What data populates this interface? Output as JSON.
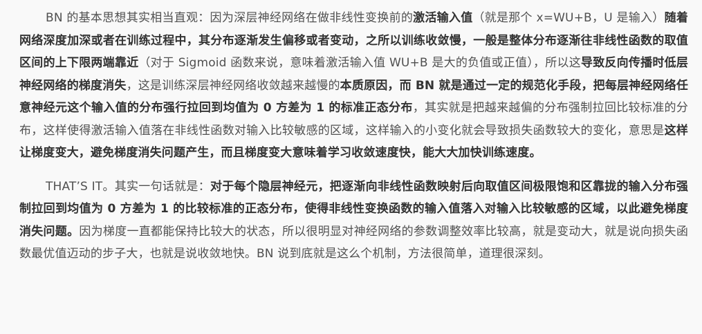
{
  "paragraph_1": [
    {
      "text": "BN 的基本思想其实相当直观：因为深层神经网络在做非线性变换前的",
      "bold": false
    },
    {
      "text": "激活输入值",
      "bold": true
    },
    {
      "text": "（就是那个 x=WU+B，U 是输入）",
      "bold": false
    },
    {
      "text": "随着网络深度加深或者在训练过程中，其分布逐渐发生偏移或者变动，之所以训练收敛慢，一般是整体分布逐渐往非线性函数的取值区间的上下限两端靠近",
      "bold": true
    },
    {
      "text": "（对于 Sigmoid 函数来说，意味着激活输入值 WU+B 是大的负值或正值），所以这",
      "bold": false
    },
    {
      "text": "导致反向传播时低层神经网络的梯度消失",
      "bold": true
    },
    {
      "text": "，这是训练深层神经网络收敛越来越慢的",
      "bold": false
    },
    {
      "text": "本质原因",
      "bold": true
    },
    {
      "text": "，",
      "bold": false
    },
    {
      "text": "而 BN 就是通过一定的规范化手段，把每层神经网络任意神经元这个输入值的分布强行拉回到均值为 0 方差为 1 的标准正态分布",
      "bold": true
    },
    {
      "text": "，其实就是把越来越偏的分布强制拉回比较标准的分布，这样使得激活输入值落在非线性函数对输入比较敏感的区域，这样输入的小变化就会导致损失函数较大的变化，意思是",
      "bold": false
    },
    {
      "text": "这样让梯度变大，避免梯度消失问题产生，而且梯度变大意味着学习收敛速度快，能大大加快训练速度。",
      "bold": true
    }
  ],
  "paragraph_2": [
    {
      "text": "THAT’S IT。其实一句话就是：",
      "bold": false
    },
    {
      "text": "对于每个隐层神经元，把逐渐向非线性函数映射后向取值区间极限饱和区靠拢的输入分布强制拉回到均值为 0 方差为 1 的比较标准的正态分布，使得非线性变换函数的输入值落入对输入比较敏感的区域，以此避免梯度消失问题。",
      "bold": true
    },
    {
      "text": "因为梯度一直都能保持比较大的状态，所以很明显对神经网络的参数调整效率比较高，就是变动大，就是说向损失函数最优值迈动的步子大，也就是说收敛地快。BN 说到底就是这么个机制，方法很简单，道理很深刻。",
      "bold": false
    }
  ]
}
